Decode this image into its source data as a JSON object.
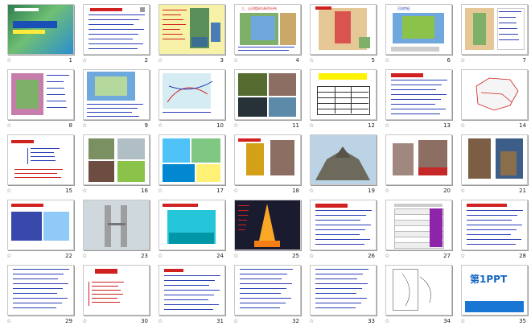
{
  "slides": [
    {
      "number": "1"
    },
    {
      "number": "2"
    },
    {
      "number": "3"
    },
    {
      "number": "4"
    },
    {
      "number": "5"
    },
    {
      "number": "6"
    },
    {
      "number": "7"
    },
    {
      "number": "8"
    },
    {
      "number": "9"
    },
    {
      "number": "10"
    },
    {
      "number": "11"
    },
    {
      "number": "12"
    },
    {
      "number": "13"
    },
    {
      "number": "14"
    },
    {
      "number": "15"
    },
    {
      "number": "16"
    },
    {
      "number": "17"
    },
    {
      "number": "18"
    },
    {
      "number": "19"
    },
    {
      "number": "20"
    },
    {
      "number": "21"
    },
    {
      "number": "22"
    },
    {
      "number": "23"
    },
    {
      "number": "24"
    },
    {
      "number": "25"
    },
    {
      "number": "26"
    },
    {
      "number": "27"
    },
    {
      "number": "28"
    },
    {
      "number": "29"
    },
    {
      "number": "30"
    },
    {
      "number": "31"
    },
    {
      "number": "32"
    },
    {
      "number": "33"
    },
    {
      "number": "34"
    },
    {
      "number": "35"
    }
  ],
  "star_glyph": "☆",
  "slide_labels": {
    "s4_title": "三、山河相间与纵列分布",
    "s6_title": "河流特征",
    "s35_logo_num": "第1",
    "s35_logo_txt": "PPT"
  },
  "colors": {
    "text_blue": "#2b3fb6",
    "text_red": "#d02020",
    "map_green": "#7fb069",
    "sea_blue": "#6fa8dc",
    "land_tan": "#e6c896",
    "yellow": "#fff200"
  }
}
